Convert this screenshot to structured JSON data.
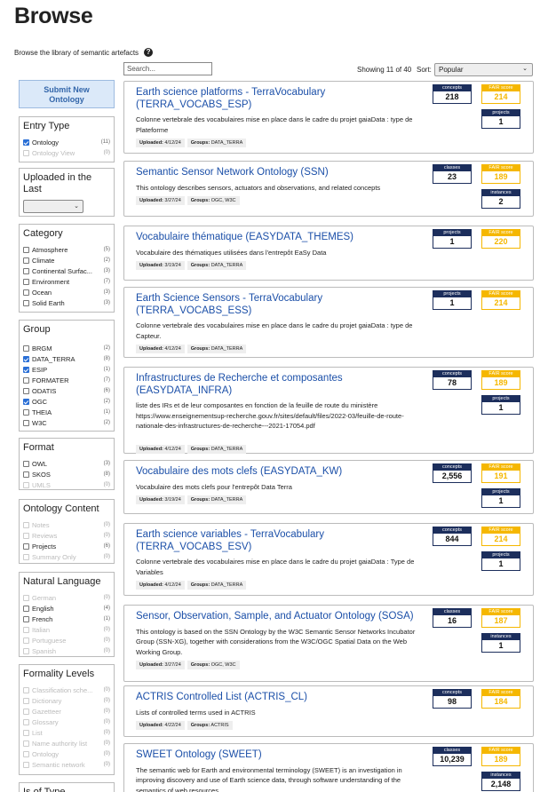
{
  "page": {
    "title": "Browse",
    "subtitle": "Browse the library of semantic artefacts"
  },
  "search": {
    "placeholder": "Search..."
  },
  "results": {
    "showing": "Showing 11 of 40",
    "sort_label": "Sort:",
    "sort_value": "Popular"
  },
  "submit_button": {
    "line1": "Submit New",
    "line2": "Ontology"
  },
  "filters": {
    "entry_type": {
      "title": "Entry Type",
      "items": [
        {
          "label": "Ontology",
          "count": "(11)",
          "checked": true,
          "disabled": false
        },
        {
          "label": "Ontology View",
          "count": "(0)",
          "checked": false,
          "disabled": true
        }
      ]
    },
    "uploaded": {
      "title": "Uploaded in the Last"
    },
    "category": {
      "title": "Category",
      "items": [
        {
          "label": "Atmosphere",
          "count": "(5)",
          "checked": false,
          "disabled": false
        },
        {
          "label": "Climate",
          "count": "(2)",
          "checked": false,
          "disabled": false
        },
        {
          "label": "Continental Surfac...",
          "count": "(3)",
          "checked": false,
          "disabled": false
        },
        {
          "label": "Environment",
          "count": "(7)",
          "checked": false,
          "disabled": false
        },
        {
          "label": "Ocean",
          "count": "(3)",
          "checked": false,
          "disabled": false
        },
        {
          "label": "Solid Earth",
          "count": "(3)",
          "checked": false,
          "disabled": false
        }
      ]
    },
    "group": {
      "title": "Group",
      "items": [
        {
          "label": "BRGM",
          "count": "(2)",
          "checked": false,
          "disabled": false
        },
        {
          "label": "DATA_TERRA",
          "count": "(8)",
          "checked": true,
          "disabled": false
        },
        {
          "label": "ESIP",
          "count": "(1)",
          "checked": true,
          "disabled": false
        },
        {
          "label": "FORMATER",
          "count": "(7)",
          "checked": false,
          "disabled": false
        },
        {
          "label": "ODATIS",
          "count": "(6)",
          "checked": false,
          "disabled": false
        },
        {
          "label": "OGC",
          "count": "(2)",
          "checked": true,
          "disabled": false
        },
        {
          "label": "THEIA",
          "count": "(1)",
          "checked": false,
          "disabled": false
        },
        {
          "label": "W3C",
          "count": "(2)",
          "checked": false,
          "disabled": false
        }
      ]
    },
    "format": {
      "title": "Format",
      "items": [
        {
          "label": "OWL",
          "count": "(3)",
          "checked": false,
          "disabled": false
        },
        {
          "label": "SKOS",
          "count": "(8)",
          "checked": false,
          "disabled": false
        },
        {
          "label": "UMLS",
          "count": "(0)",
          "checked": false,
          "disabled": true
        }
      ]
    },
    "ontology_content": {
      "title": "Ontology Content",
      "items": [
        {
          "label": "Notes",
          "count": "(0)",
          "checked": false,
          "disabled": true
        },
        {
          "label": "Reviews",
          "count": "(0)",
          "checked": false,
          "disabled": true
        },
        {
          "label": "Projects",
          "count": "(6)",
          "checked": false,
          "disabled": false
        },
        {
          "label": "Summary Only",
          "count": "(0)",
          "checked": false,
          "disabled": true
        }
      ]
    },
    "natural_language": {
      "title": "Natural Language",
      "items": [
        {
          "label": "German",
          "count": "(0)",
          "checked": false,
          "disabled": true
        },
        {
          "label": "English",
          "count": "(4)",
          "checked": false,
          "disabled": false
        },
        {
          "label": "French",
          "count": "(1)",
          "checked": false,
          "disabled": false
        },
        {
          "label": "Italian",
          "count": "(0)",
          "checked": false,
          "disabled": true
        },
        {
          "label": "Portuguese",
          "count": "(0)",
          "checked": false,
          "disabled": true
        },
        {
          "label": "Spanish",
          "count": "(0)",
          "checked": false,
          "disabled": true
        }
      ]
    },
    "formality": {
      "title": "Formality Levels",
      "items": [
        {
          "label": "Classification sche...",
          "count": "(0)",
          "checked": false,
          "disabled": true
        },
        {
          "label": "Dictionary",
          "count": "(0)",
          "checked": false,
          "disabled": true
        },
        {
          "label": "Gazetteer",
          "count": "(0)",
          "checked": false,
          "disabled": true
        },
        {
          "label": "Glossary",
          "count": "(0)",
          "checked": false,
          "disabled": true
        },
        {
          "label": "List",
          "count": "(0)",
          "checked": false,
          "disabled": true
        },
        {
          "label": "Name authority list",
          "count": "(0)",
          "checked": false,
          "disabled": true
        },
        {
          "label": "Ontology",
          "count": "(0)",
          "checked": false,
          "disabled": true
        },
        {
          "label": "Semantic network",
          "count": "(0)",
          "checked": false,
          "disabled": true
        }
      ]
    },
    "is_of_type": {
      "title": "Is of Type"
    }
  },
  "cards": [
    {
      "title": "Earth science platforms - TerraVocabulary (TERRA_VOCABS_ESP)",
      "description": "Colonne vertebrale des vocabulaires mise en place dans le cadre du projet gaiaData : type de Plateforme",
      "uploaded": "4/12/24",
      "groups": "DATA_TERRA",
      "metric_label": "concepts",
      "metric_value": "218",
      "fair": "214",
      "second_label": "projects",
      "second_value": "1"
    },
    {
      "title": "Semantic Sensor Network Ontology (SSN)",
      "description": "This ontology describes sensors, actuators and observations, and related concepts",
      "uploaded": "3/27/24",
      "groups": "OGC, W3C",
      "metric_label": "classes",
      "metric_value": "23",
      "fair": "189",
      "second_label": "instances",
      "second_value": "2"
    },
    {
      "title": "Vocabulaire thématique (EASYDATA_THEMES)",
      "description": "Vocabulaire des thématiques utilisées dans l'entrepôt EaSy Data",
      "uploaded": "3/19/24",
      "groups": "DATA_TERRA",
      "metric_label": "projects",
      "metric_value": "1",
      "fair": "220",
      "second_label": "",
      "second_value": ""
    },
    {
      "title": "Earth Science Sensors - TerraVocabulary (TERRA_VOCABS_ESS)",
      "description": "Colonne vertebrale des vocabulaires mise en place dans le cadre du projet gaiaData : type de Capteur.",
      "uploaded": "4/12/24",
      "groups": "DATA_TERRA",
      "metric_label": "projects",
      "metric_value": "1",
      "fair": "214",
      "second_label": "",
      "second_value": ""
    },
    {
      "title": "Infrastructures de Recherche et composantes (EASYDATA_INFRA)",
      "description": "liste des IRs et de leur composantes en fonction de la feuille de route du ministère https://www.enseignementsup-recherche.gouv.fr/sites/default/files/2022-03/feuille-de-route-nationale-des-infrastructures-de-recherche---2021-17054.pdf",
      "uploaded": "4/12/24",
      "groups": "DATA_TERRA",
      "metric_label": "concepts",
      "metric_value": "78",
      "fair": "189",
      "second_label": "projects",
      "second_value": "1"
    },
    {
      "title": "Vocabulaire des mots clefs (EASYDATA_KW)",
      "description": "Vocabulaire des mots clefs pour l'entrepôt Data Terra",
      "uploaded": "3/19/24",
      "groups": "DATA_TERRA",
      "metric_label": "concepts",
      "metric_value": "2,556",
      "fair": "191",
      "second_label": "projects",
      "second_value": "1"
    },
    {
      "title": "Earth science variables - TerraVocabulary (TERRA_VOCABS_ESV)",
      "description": "Colonne vertebrale des vocabulaires mise en place dans le cadre du projet gaiaData : Type de Variables",
      "uploaded": "4/12/24",
      "groups": "DATA_TERRA",
      "metric_label": "concepts",
      "metric_value": "844",
      "fair": "214",
      "second_label": "projects",
      "second_value": "1"
    },
    {
      "title": "Sensor, Observation, Sample, and Actuator Ontology (SOSA)",
      "description": "This ontology is based on the SSN Ontology by the W3C Semantic Sensor Networks Incubator Group (SSN-XG), together with considerations from the W3C/OGC Spatial Data on the Web Working Group.",
      "uploaded": "3/27/24",
      "groups": "OGC, W3C",
      "metric_label": "classes",
      "metric_value": "16",
      "fair": "187",
      "second_label": "instances",
      "second_value": "1"
    },
    {
      "title": "ACTRIS Controlled List (ACTRIS_CL)",
      "description": "Lists of controlled terms used in ACTRIS",
      "uploaded": "4/22/24",
      "groups": "ACTRIS",
      "metric_label": "concepts",
      "metric_value": "98",
      "fair": "184",
      "second_label": "",
      "second_value": ""
    },
    {
      "title": "SWEET Ontology (SWEET)",
      "description": "The semantic web for Earth and environmental terminology (SWEET) is an investigation in improving discovery and use of Earth science data, through software understanding of the semantics of web resources",
      "uploaded": "",
      "groups": "",
      "metric_label": "classes",
      "metric_value": "10,239",
      "fair": "189",
      "second_label": "instances",
      "second_value": "2,148"
    }
  ],
  "labels": {
    "uploaded": "Uploaded:",
    "groups": "Groups:",
    "fair_score": "FAIR score"
  }
}
